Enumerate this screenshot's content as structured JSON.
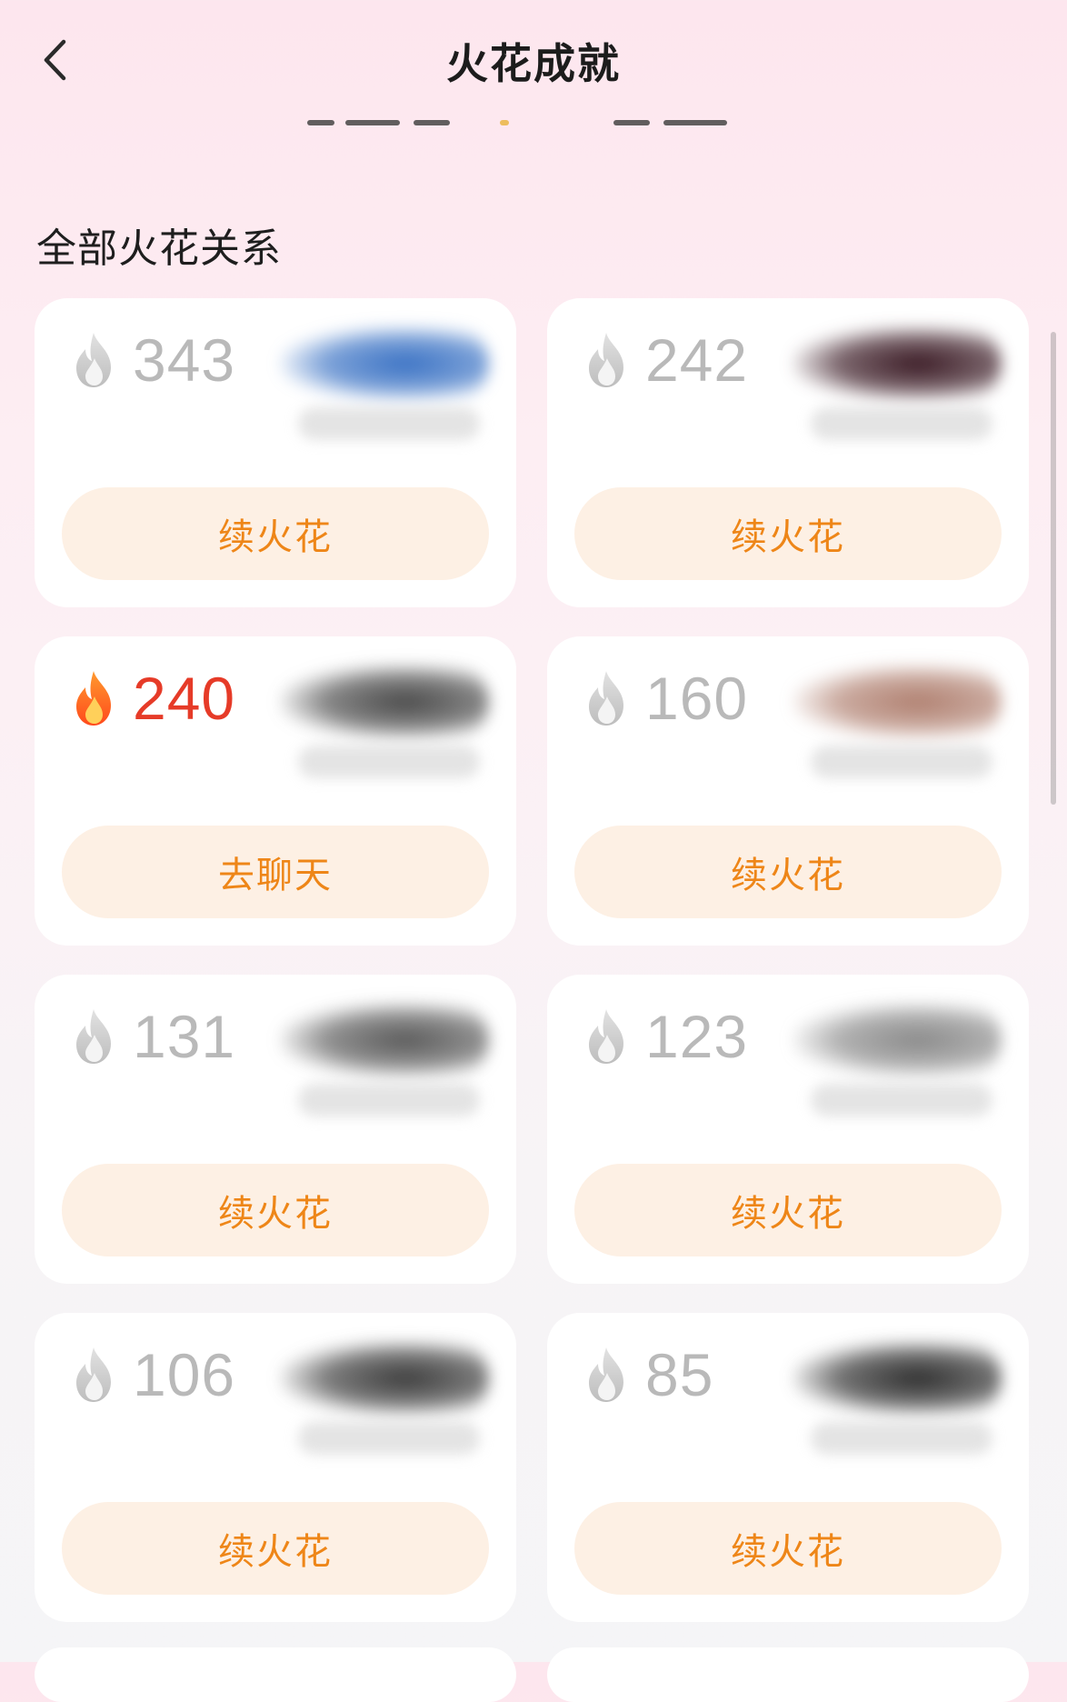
{
  "header": {
    "title": "火花成就"
  },
  "section": {
    "title": "全部火花关系"
  },
  "colors": {
    "accent_orange": "#ee8618",
    "button_bg": "#fdf0e4",
    "active_count": "#e63b28",
    "inactive_count": "#b9b9b9"
  },
  "cards": [
    {
      "count": "343",
      "action": "续火花",
      "active": false,
      "icon": "gray-flame-icon",
      "blur": "#3a72c4"
    },
    {
      "count": "242",
      "action": "续火花",
      "active": false,
      "icon": "gray-flame-icon",
      "blur": "#3a1a24"
    },
    {
      "count": "240",
      "action": "去聊天",
      "active": true,
      "icon": "fire-flame-icon",
      "blur": "#4a4a4a"
    },
    {
      "count": "160",
      "action": "续火花",
      "active": false,
      "icon": "gray-flame-icon",
      "blur": "#b08070"
    },
    {
      "count": "131",
      "action": "续火花",
      "active": false,
      "icon": "gray-flame-icon",
      "blur": "#5a5a5a"
    },
    {
      "count": "123",
      "action": "续火花",
      "active": false,
      "icon": "gray-flame-icon",
      "blur": "#8a8a8a"
    },
    {
      "count": "106",
      "action": "续火花",
      "active": false,
      "icon": "gray-flame-icon",
      "blur": "#3c3c3c"
    },
    {
      "count": "85",
      "action": "续火花",
      "active": false,
      "icon": "gray-flame-icon",
      "blur": "#2e2e2e"
    }
  ]
}
